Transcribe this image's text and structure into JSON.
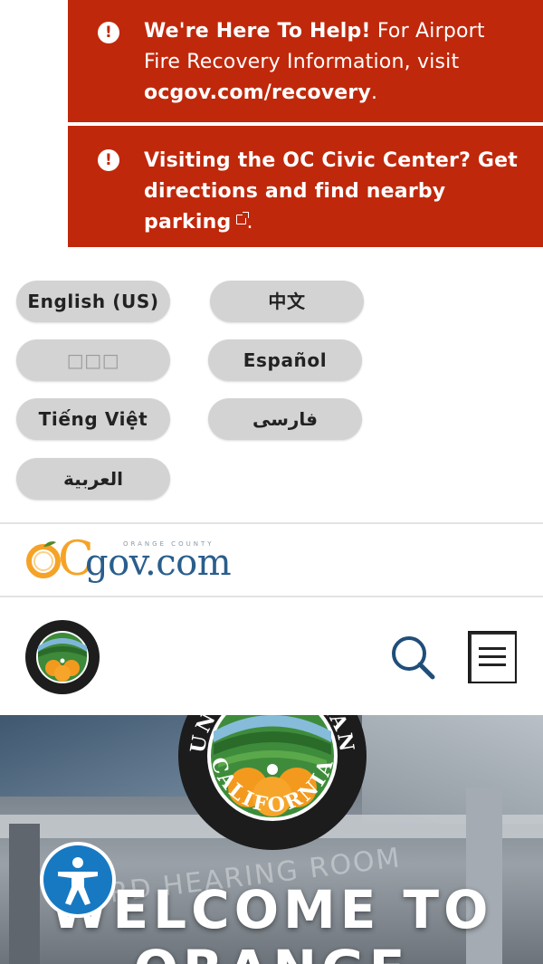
{
  "alerts": [
    {
      "icon": "alert-circle-icon",
      "bold_lead": "We're Here To Help!",
      "text": " For Airport Fire Recovery Information, visit ",
      "link": "ocgov.com/recovery",
      "tail": "."
    },
    {
      "icon": "alert-circle-icon",
      "bold_lead": "Visiting the OC Civic Center? Get directions and find nearby parking",
      "tail": ".",
      "link_icon": "external-link-icon"
    }
  ],
  "languages": {
    "english": "English (US)",
    "chinese": "中文",
    "korean": "□□□",
    "spanish": "Español",
    "vietnamese": "Tiếng Việt",
    "farsi": "فارسی",
    "arabic": "العربية"
  },
  "logo": {
    "tagline": "ORANGE COUNTY",
    "c": "C",
    "gov": "gov.com"
  },
  "header": {
    "search_icon": "search-icon",
    "menu_icon": "hamburger-menu-icon"
  },
  "hero": {
    "room_sign": "RD HEARING ROOM",
    "seal_top": "COUNTY OF ORANGE",
    "seal_bottom": "CALIFORNIA",
    "welcome": "WELCOME TO ORANGE"
  },
  "accessibility": {
    "icon": "accessibility-person-icon"
  },
  "colors": {
    "alert_red": "#c0280b",
    "lang_button_gray": "#d3d3d3",
    "brand_blue": "#2a5e8c",
    "brand_orange": "#f5a327",
    "a11y_blue": "#1779c2"
  }
}
